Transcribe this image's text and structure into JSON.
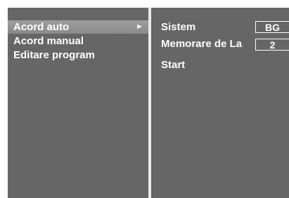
{
  "menu": {
    "items": [
      {
        "label": "Acord auto",
        "selected": true,
        "arrow": "►"
      },
      {
        "label": "Acord manual",
        "selected": false
      },
      {
        "label": "Editare program",
        "selected": false
      }
    ]
  },
  "submenu": {
    "options": [
      {
        "label": "Sistem",
        "value": "BG"
      },
      {
        "label": "Memorare de La",
        "value": "2"
      },
      {
        "label": "Start"
      }
    ]
  }
}
